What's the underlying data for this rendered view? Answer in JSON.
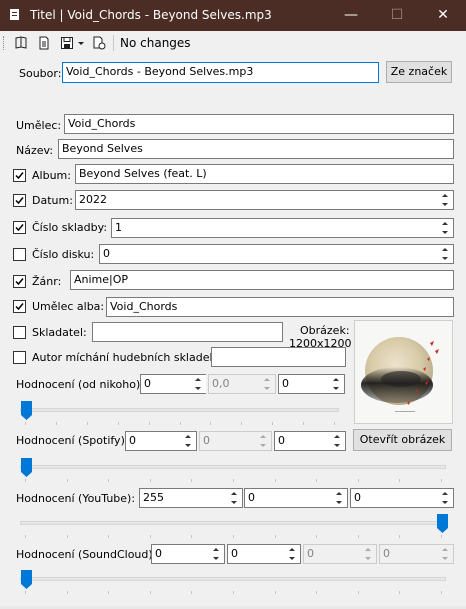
{
  "window": {
    "title": "Titel | Void_Chords - Beyond Selves.mp3",
    "minimize": "—",
    "maximize": "☐",
    "close": "✕"
  },
  "toolbar": {
    "status": "No changes"
  },
  "file": {
    "label": "Soubor:",
    "value": "Void_Chords - Beyond Selves.mp3",
    "from_tags_button": "Ze značek"
  },
  "fields": {
    "artist": {
      "label": "Umělec:",
      "value": "Void_Chords"
    },
    "title": {
      "label": "Název:",
      "value": "Beyond Selves"
    },
    "album": {
      "label": "Album:",
      "value": "Beyond Selves (feat. L)",
      "checked": true
    },
    "date": {
      "label": "Datum:",
      "value": "2022",
      "checked": true
    },
    "track": {
      "label": "Číslo skladby:",
      "value": "1",
      "checked": true
    },
    "disc": {
      "label": "Číslo disku:",
      "value": "0",
      "checked": false
    },
    "genre": {
      "label": "Žánr:",
      "value": "Anime|OP",
      "checked": true
    },
    "album_artist": {
      "label": "Umělec alba:",
      "value": "Void_Chords",
      "checked": true
    },
    "composer": {
      "label": "Skladatel:",
      "value": "",
      "checked": false
    },
    "remixer": {
      "label": "Autor míchání hudebních skladeb:",
      "value": "",
      "checked": false
    }
  },
  "image": {
    "label": "Obrázek:",
    "size": "1200x1200",
    "open_button": "Otevřít obrázek"
  },
  "ratings": {
    "nobody": {
      "label": "Hodnocení (od nikoho):",
      "v1": "0",
      "v2": "0,0",
      "v3": "0",
      "slider": 0.0
    },
    "spotify": {
      "label": "Hodnocení (Spotify):",
      "v1": "0",
      "v2": "0",
      "v3": "0",
      "slider": 0.0
    },
    "youtube": {
      "label": "Hodnocení (YouTube):",
      "v1": "255",
      "v2": "0",
      "v3": "0",
      "slider": 1.0
    },
    "soundcloud": {
      "label": "Hodnocení (SoundCloud):",
      "v1": "0",
      "v2": "0",
      "v3": "0",
      "v4": "0",
      "slider": 0.0
    }
  },
  "colors": {
    "titlebar": "#4b2d26",
    "accent": "#0078d7"
  }
}
